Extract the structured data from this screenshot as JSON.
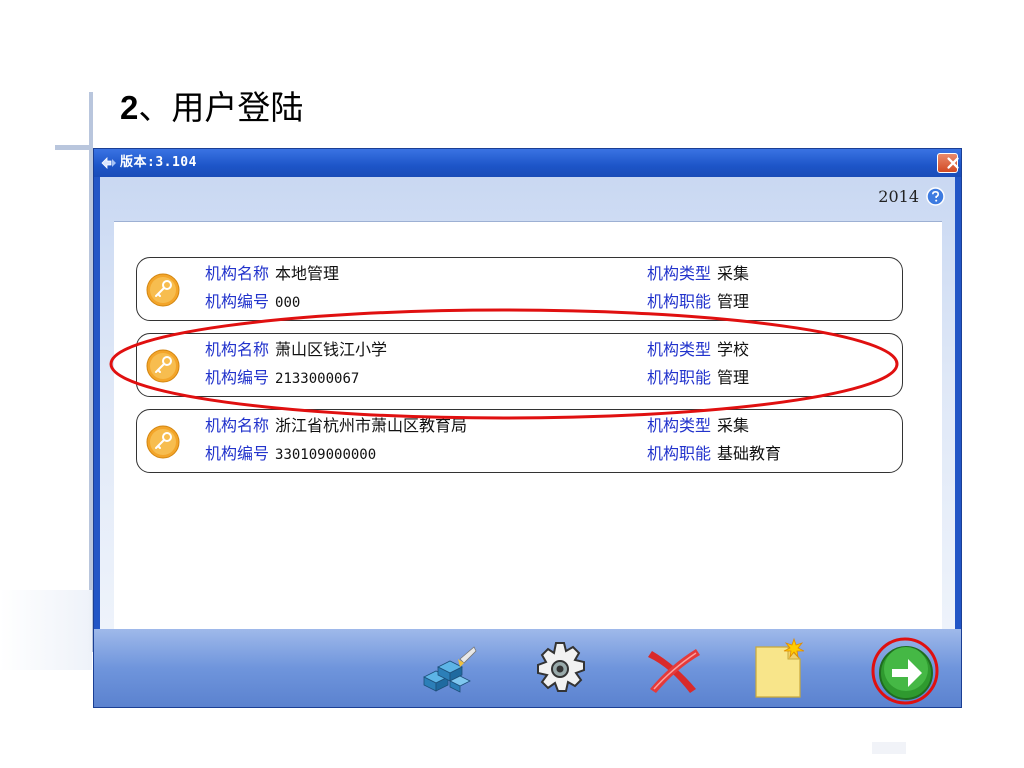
{
  "slide": {
    "title_num": "2",
    "title_text": "、用户登陆"
  },
  "window": {
    "title": "版本:3.104",
    "year": "2014",
    "close_icon": "close-icon",
    "help_icon": "help-icon"
  },
  "orgs": [
    {
      "name_label": "机构名称",
      "name": "本地管理",
      "code_label": "机构编号",
      "code": "000",
      "type_label": "机构类型",
      "type": "采集",
      "func_label": "机构职能",
      "func": "管理"
    },
    {
      "name_label": "机构名称",
      "name": "萧山区钱江小学",
      "code_label": "机构编号",
      "code": "2133000067",
      "type_label": "机构类型",
      "type": "学校",
      "func_label": "机构职能",
      "func": "管理"
    },
    {
      "name_label": "机构名称",
      "name": "浙江省杭州市萧山区教育局",
      "code_label": "机构编号",
      "code": "330109000000",
      "type_label": "机构类型",
      "type": "采集",
      "func_label": "机构职能",
      "func": "基础教育"
    }
  ],
  "toolbar": {
    "icons": [
      "database-icon",
      "gear-icon",
      "delete-icon",
      "new-file-icon",
      "next-arrow-icon"
    ]
  },
  "colors": {
    "label_blue": "#2233cc",
    "window_blue": "#2356c6",
    "annotation_red": "#e01010",
    "next_green": "#2f9a2f"
  }
}
